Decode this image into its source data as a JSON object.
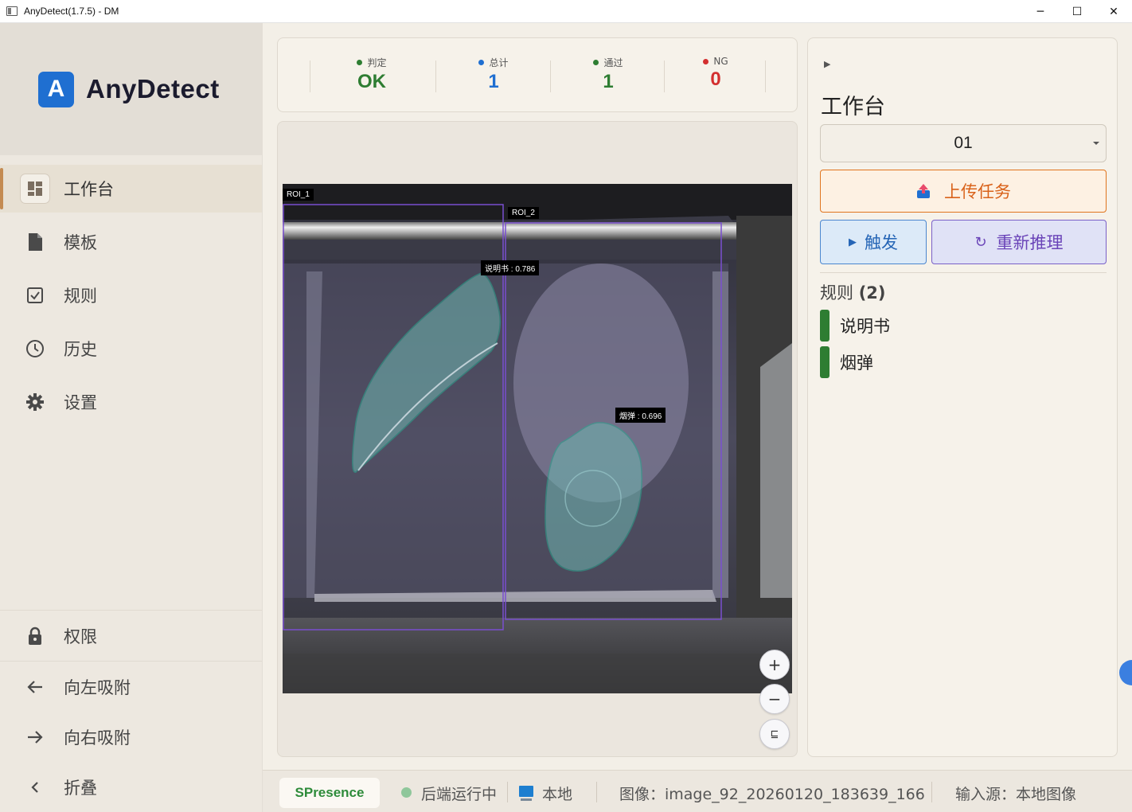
{
  "window": {
    "title": "AnyDetect(1.7.5) - DM",
    "minimize": "─",
    "maximize": "☐",
    "close": "✕"
  },
  "brand": {
    "mark": "A",
    "name": "AnyDetect",
    "color": "#1f6fd1"
  },
  "nav": {
    "items": [
      {
        "label": "工作台",
        "icon": "dashboard-icon",
        "active": true
      },
      {
        "label": "模板",
        "icon": "file-icon"
      },
      {
        "label": "规则",
        "icon": "checkbox-icon"
      },
      {
        "label": "历史",
        "icon": "clock-icon"
      },
      {
        "label": "设置",
        "icon": "gear-icon"
      }
    ],
    "bottom": [
      {
        "label": "权限",
        "icon": "lock-icon"
      },
      {
        "label": "向左吸附",
        "icon": "arrow-left-icon"
      },
      {
        "label": "向右吸附",
        "icon": "arrow-right-icon"
      },
      {
        "label": "折叠",
        "icon": "chevron-left-icon"
      }
    ]
  },
  "stats": [
    {
      "label": "判定",
      "value": "OK",
      "color": "#2e7d32",
      "dot": "#2e7d32"
    },
    {
      "label": "总计",
      "value": "1",
      "color": "#1f6fd1",
      "dot": "#1f6fd1"
    },
    {
      "label": "通过",
      "value": "1",
      "color": "#2e7d32",
      "dot": "#2e7d32"
    },
    {
      "label": "NG",
      "value": "0",
      "color": "#d32f2f",
      "dot": "#d32f2f"
    }
  ],
  "viewer": {
    "rois": [
      {
        "label": "ROI_1"
      },
      {
        "label": "ROI_2"
      }
    ],
    "detections": [
      {
        "label": "说明书 : 0.786"
      },
      {
        "label": "烟弹 : 0.696"
      }
    ],
    "zoom_in": "+",
    "zoom_out": "−",
    "fit": "⊑"
  },
  "panel": {
    "collapse_arrow": "▶",
    "title": "工作台",
    "select_value": "01",
    "upload_label": "上传任务",
    "trigger_icon": "▶",
    "trigger_label": "触发",
    "reinfer_icon": "↻",
    "reinfer_label": "重新推理",
    "rules_label": "规则",
    "rules_count": "(2)",
    "rules": [
      {
        "name": "说明书",
        "color": "#2e7d32"
      },
      {
        "name": "烟弹",
        "color": "#2e7d32"
      }
    ]
  },
  "status": {
    "badge": "SPresence",
    "backend": "后端运行中",
    "source_mode": "本地",
    "image": "图像：image_92_20260120_183639_166",
    "input": "输入源：本地图像"
  }
}
